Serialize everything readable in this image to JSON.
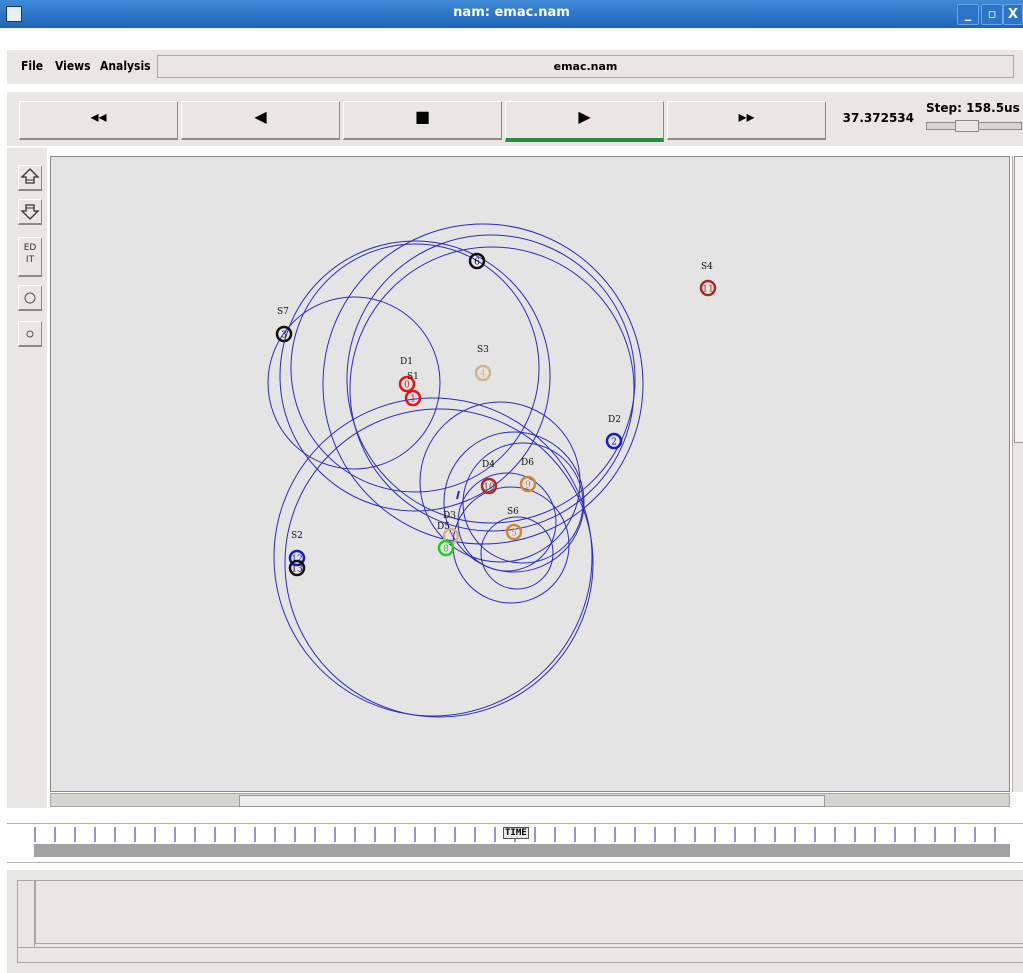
{
  "window": {
    "title": "nam: emac.nam",
    "controls": [
      "_",
      "▫",
      "X"
    ]
  },
  "menubar": {
    "items": [
      "File",
      "Views",
      "Analysis"
    ],
    "file_name": "emac.nam"
  },
  "transport": {
    "buttons": [
      {
        "name": "rewind-button",
        "glyph": "◂◂"
      },
      {
        "name": "step-back-button",
        "glyph": "◀"
      },
      {
        "name": "stop-button",
        "glyph": "■"
      },
      {
        "name": "play-button",
        "glyph": "▶",
        "active": true
      },
      {
        "name": "fast-forward-button",
        "glyph": "▸▸"
      }
    ],
    "time_value": "37.372534",
    "step_label": "Step: 158.5us"
  },
  "left_toolbar": {
    "edit_label": "ED IT"
  },
  "canvas": {
    "background": "#e4e4e4",
    "range_circle_color": "#2a2ac0",
    "nodes": [
      {
        "id": "6",
        "label": "",
        "color": "#111111"
      },
      {
        "id": "11",
        "label": "S4",
        "color": "#a52a2a"
      },
      {
        "id": "3",
        "label": "S7",
        "color": "#111111"
      },
      {
        "id": "4",
        "label": "S3",
        "color": "#d2b48c"
      },
      {
        "id": "0",
        "label": "D1",
        "color": "#ee1111"
      },
      {
        "id": "1",
        "label": "S1",
        "color": "#ee1111"
      },
      {
        "id": "2",
        "label": "D2",
        "color": "#1818cc"
      },
      {
        "id": "10",
        "label": "D4",
        "color": "#a52a2a"
      },
      {
        "id": "9",
        "label": "D6",
        "color": "#cd853f"
      },
      {
        "id": "5",
        "label": "S6",
        "color": "#cd853f"
      },
      {
        "id": "7",
        "label": "D3",
        "color": "#d2b48c"
      },
      {
        "id": "8",
        "label": "D5",
        "color": "#22cc22"
      },
      {
        "id": "12",
        "label": "S2",
        "color": "#1818cc"
      },
      {
        "id": "13",
        "label": "",
        "color": "#111111"
      }
    ]
  },
  "timeline": {
    "label": "TIME"
  }
}
